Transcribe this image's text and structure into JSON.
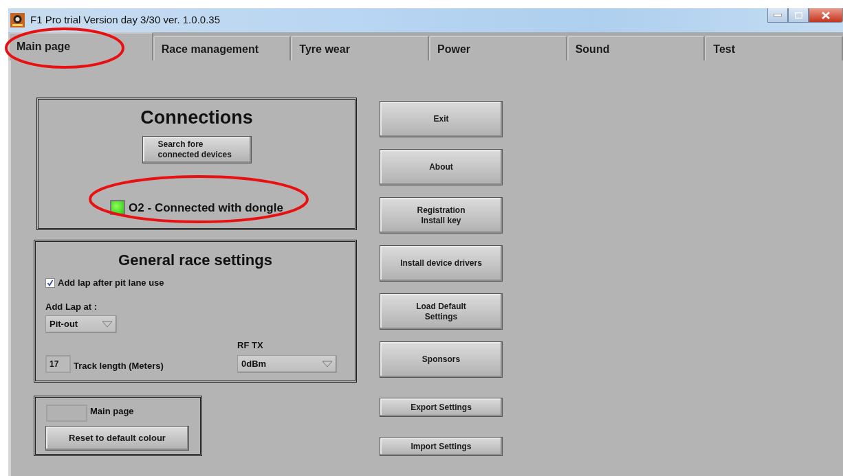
{
  "window": {
    "title": "F1 Pro trial Version day 3/30 ver. 1.0.0.35"
  },
  "tabs": [
    {
      "label": "Main page",
      "selected": true,
      "circled": true
    },
    {
      "label": "Race management",
      "selected": false,
      "circled": false
    },
    {
      "label": "Tyre wear",
      "selected": false,
      "circled": false
    },
    {
      "label": "Power",
      "selected": false,
      "circled": false
    },
    {
      "label": "Sound",
      "selected": false,
      "circled": false
    },
    {
      "label": "Test",
      "selected": false,
      "circled": false
    }
  ],
  "connections": {
    "title": "Connections",
    "search_button": "Search fore\nconnected devices",
    "status": {
      "text": "O2 - Connected with dongle",
      "connected": true,
      "circled": true
    }
  },
  "general": {
    "title": "General race settings",
    "add_lap_after_pit": {
      "label": "Add lap after pit lane use",
      "checked": true
    },
    "add_lap_at": {
      "label": "Add Lap at :",
      "value": "Pit-out"
    },
    "track_length": {
      "value": "17",
      "label": "Track length (Meters)"
    },
    "rf_tx": {
      "label": "RF TX",
      "value": "0dBm"
    }
  },
  "colour": {
    "label": "Main page",
    "button": "Reset to default colour"
  },
  "buttons": [
    {
      "label": "Exit",
      "kind": "large"
    },
    {
      "label": "About",
      "kind": "large"
    },
    {
      "label": "Registration\nInstall key",
      "kind": "large"
    },
    {
      "label": "Install device drivers",
      "kind": "large"
    },
    {
      "label": "Load Default\nSettings",
      "kind": "large"
    },
    {
      "label": "Sponsors",
      "kind": "large"
    },
    {
      "label": "Export Settings",
      "kind": "small"
    },
    {
      "label": "Import Settings",
      "kind": "small"
    }
  ]
}
